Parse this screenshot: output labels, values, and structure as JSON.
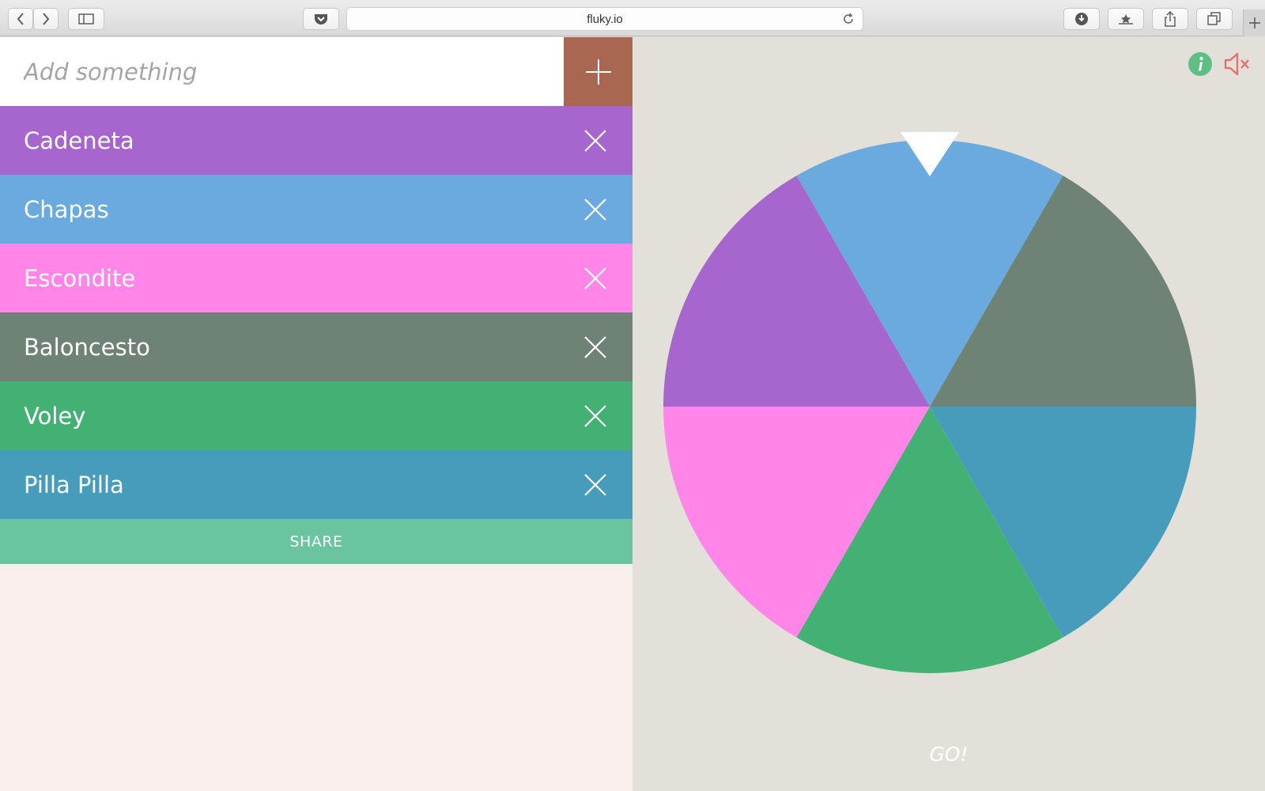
{
  "browser": {
    "url": "fluky.io"
  },
  "add": {
    "placeholder": "Add something",
    "button_color": "#a96751"
  },
  "items": [
    {
      "label": "Cadeneta",
      "color": "#a765ce"
    },
    {
      "label": "Chapas",
      "color": "#6aaade"
    },
    {
      "label": "Escondite",
      "color": "#ff86e8"
    },
    {
      "label": "Baloncesto",
      "color": "#6e8376"
    },
    {
      "label": "Voley",
      "color": "#44b174"
    },
    {
      "label": "Pilla Pilla",
      "color": "#479cbc"
    }
  ],
  "share_label": "SHARE",
  "go_label": "GO!",
  "icons": {
    "info": "info-icon",
    "mute": "mute-icon"
  },
  "colors": {
    "background_left": "#f8f0ed",
    "background_right": "#e3e0d9",
    "share": "#6bc4a0",
    "info": "#5fbf82",
    "mute": "#e4716b"
  }
}
